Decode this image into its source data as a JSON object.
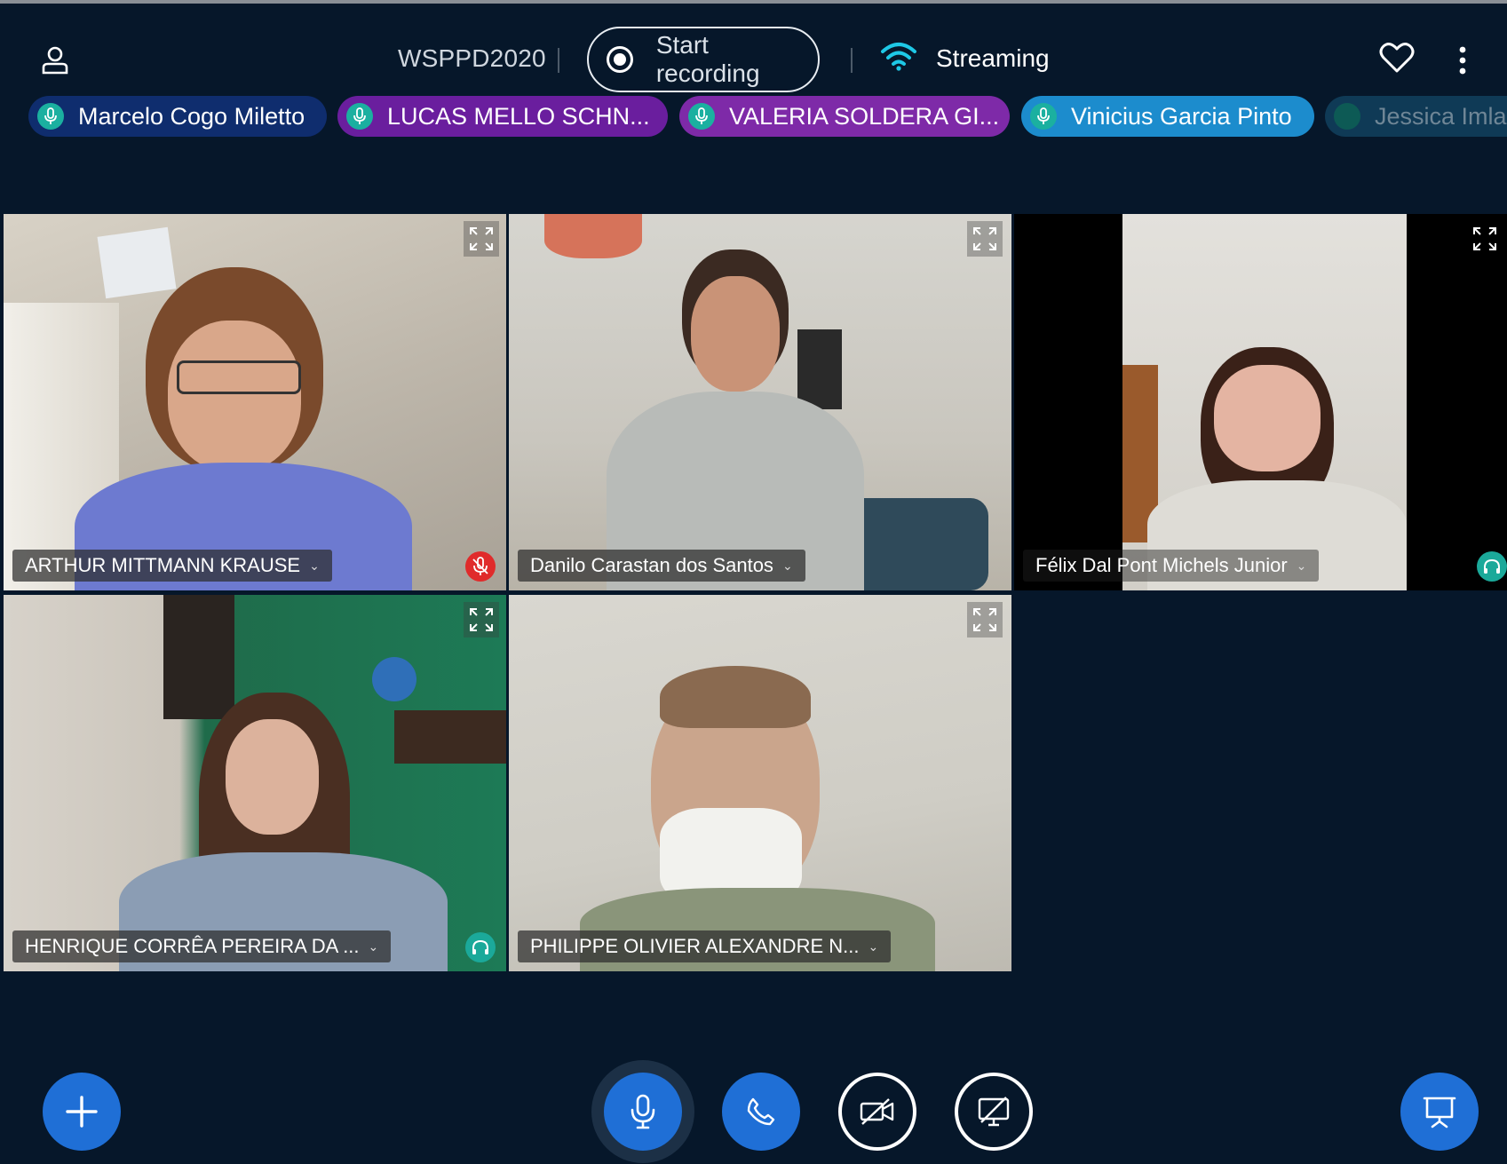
{
  "meeting": {
    "title": "WSPPD2020",
    "record_label": "Start recording",
    "streaming_label": "Streaming"
  },
  "talkers": [
    {
      "name": "Marcelo Cogo Miletto",
      "color": "#0f2d6e"
    },
    {
      "name": "LUCAS MELLO SCHN...",
      "color": "#6a1e9e"
    },
    {
      "name": "VALERIA SOLDERA GI...",
      "color": "#7e2aa8"
    },
    {
      "name": "Vinicius Garcia Pinto",
      "color": "#1c8ccd"
    },
    {
      "name": "Jessica Imla",
      "color": "#0f3a56"
    }
  ],
  "tiles": [
    {
      "name": "ARTHUR MITTMANN KRAUSE",
      "status": "muted-mic"
    },
    {
      "name": "Danilo Carastan dos Santos",
      "status": "active-speaker"
    },
    {
      "name": "Félix Dal Pont Michels Junior",
      "status": "listen-only"
    },
    {
      "name": "HENRIQUE CORRÊA PEREIRA DA ...",
      "status": "listen-only"
    },
    {
      "name": "PHILIPPE OLIVIER ALEXANDRE N...",
      "status": "none"
    }
  ],
  "colors": {
    "background": "#06172a",
    "accent_blue": "#1f6fd6",
    "active_border": "#2f8cf0",
    "muted_red": "#e02b2b",
    "listen_teal": "#1ba99a"
  }
}
